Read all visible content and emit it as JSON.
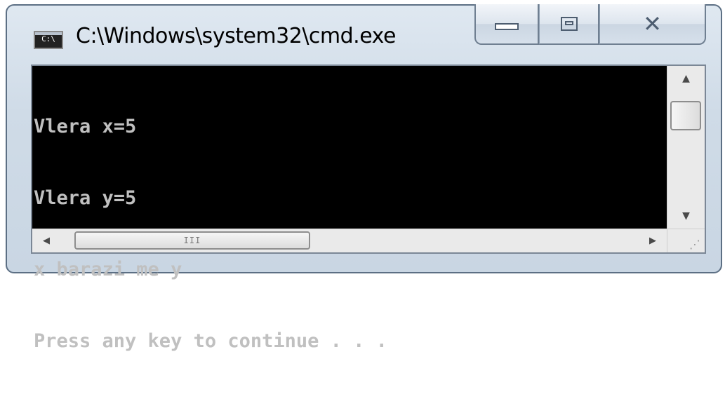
{
  "window": {
    "title": "C:\\Windows\\system32\\cmd.exe",
    "icon": "cmd-icon",
    "icon_text": "C:\\",
    "buttons": {
      "minimize": "minimize-icon",
      "maximize": "maximize-icon",
      "close": "close-icon",
      "close_glyph": "✕"
    }
  },
  "console": {
    "lines": [
      "Vlera x=5",
      "Vlera y=5",
      "x barazi me y",
      "Press any key to continue . . ."
    ],
    "background": "#000000",
    "foreground": "#c0c0c0"
  },
  "scrollbars": {
    "vertical": {
      "up_arrow": "▲",
      "down_arrow": "▼"
    },
    "horizontal": {
      "left_arrow": "◀",
      "right_arrow": "▶",
      "thumb_grip": "III"
    }
  }
}
